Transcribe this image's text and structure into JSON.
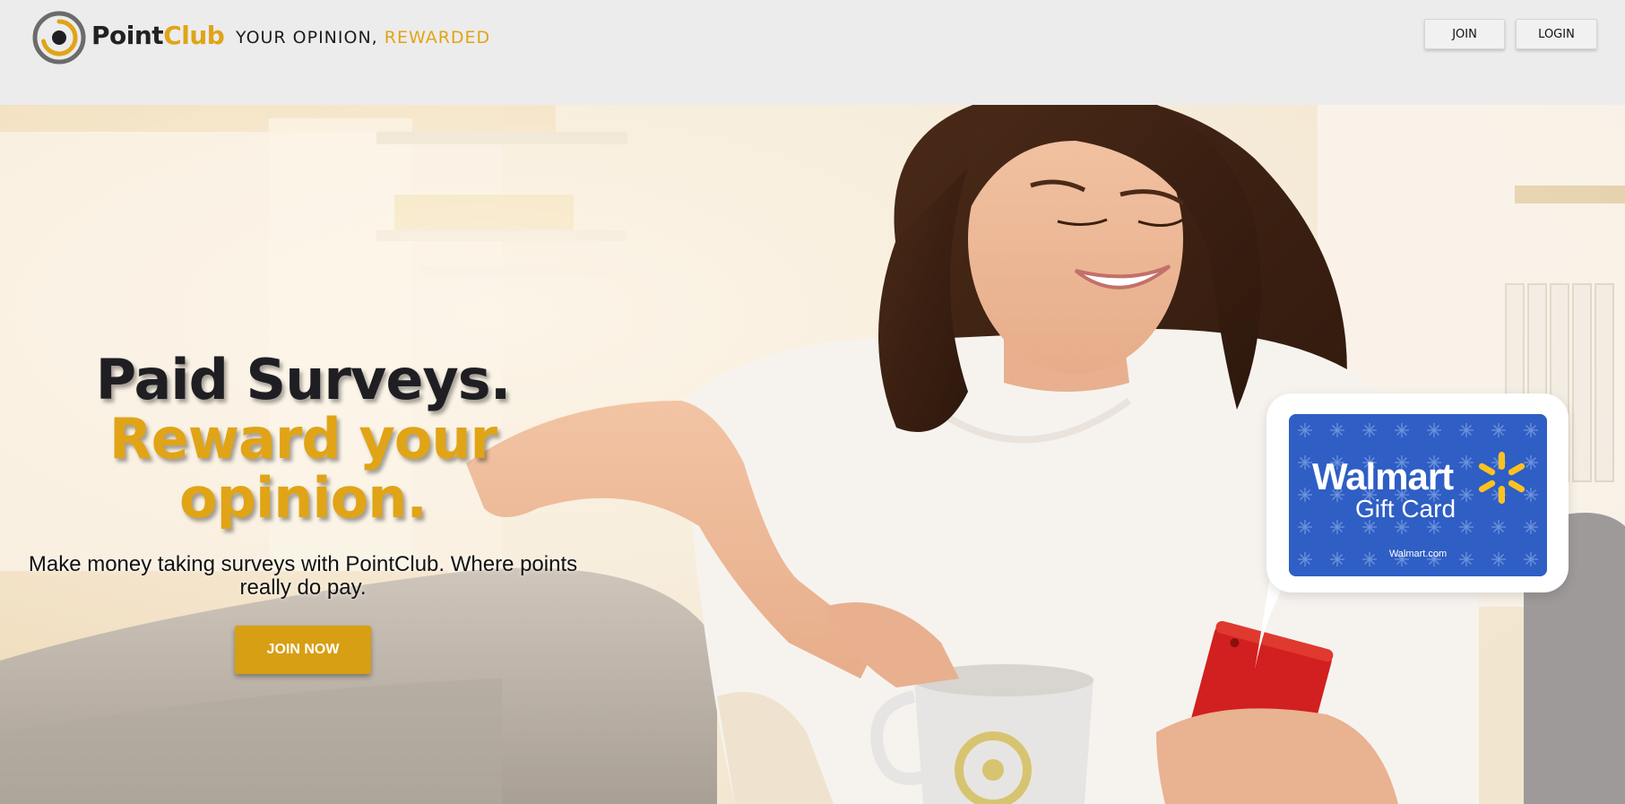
{
  "header": {
    "brand_part1": "Point",
    "brand_part2": "Club",
    "tagline_part1": "YOUR OPINION, ",
    "tagline_part2": "REWARDED",
    "join_label": "JOIN",
    "login_label": "LOGIN"
  },
  "hero": {
    "headline_line1": "Paid Surveys.",
    "headline_line2": "Reward your opinion.",
    "subtext": "Make money taking surveys with PointClub. Where points really do pay.",
    "cta_label": "JOIN NOW"
  },
  "gift_card": {
    "brand": "Walmart",
    "subtitle": "Gift Card",
    "url": "Walmart.com"
  },
  "colors": {
    "accent": "#e0a416",
    "cta": "#d79f13",
    "header_bg": "#ececec",
    "walmart_blue": "#2f5ec4",
    "walmart_spark": "#ffc220",
    "phone_red": "#d21f1f"
  },
  "icons": {
    "logo": "pointclub-target-logo-icon",
    "spark": "walmart-spark-icon"
  }
}
